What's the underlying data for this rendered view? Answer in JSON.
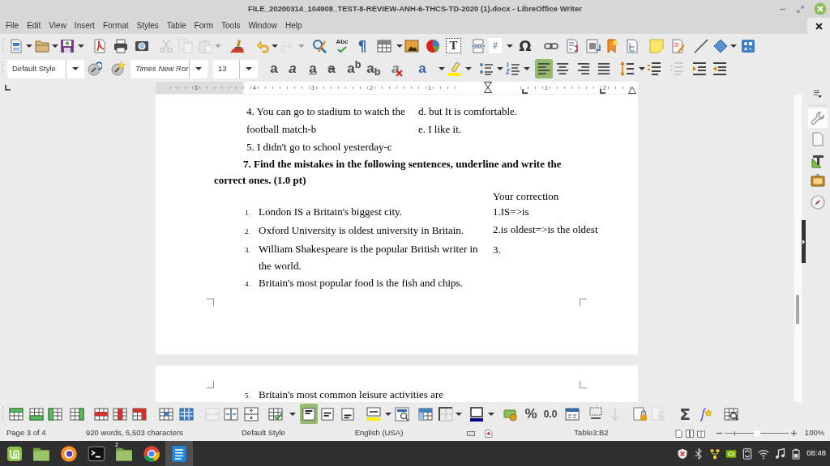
{
  "window": {
    "title": "FILE_20200314_104908_TEST-8-REVIEW-ANH-6-THCS-TD-2020 (1).docx - LibreOffice Writer"
  },
  "menu": [
    "File",
    "Edit",
    "View",
    "Insert",
    "Format",
    "Styles",
    "Table",
    "Form",
    "Tools",
    "Window",
    "Help"
  ],
  "standard_toolbar": {
    "cut": {
      "disabled": true
    },
    "copy": {
      "disabled": true
    },
    "paste": {
      "disabled": true
    },
    "redo": {
      "disabled": true
    },
    "spelling": "Abc",
    "formatting_marks": "¶",
    "text_box": "T",
    "insert_field": "#",
    "special_character": "Ω"
  },
  "formatting_toolbar": {
    "paragraph_style": "Default Style",
    "font_name": "Times New Ror",
    "font_size": "13",
    "bold": "a",
    "italic": "a",
    "underline": "a",
    "strikethrough": "a",
    "superscript": "a$^{b}$",
    "subscript": "a$_{b}$",
    "clear_formatting": "a",
    "font_color": "a",
    "alignment": [
      {
        "kind": "left",
        "selected": true
      },
      {
        "kind": "center",
        "selected": false
      },
      {
        "kind": "right",
        "selected": false
      },
      {
        "kind": "justify",
        "selected": false
      }
    ],
    "decrease_spacing": {
      "disabled": true
    }
  },
  "ruler": {
    "left_labels": [
      "5",
      "4",
      "3",
      "2",
      "1"
    ],
    "right_labels": [
      "1",
      "2"
    ]
  },
  "document": {
    "matching_table": {
      "left": [
        "4. You can go to stadium to watch the football match-b",
        "5. I didn't go to school yesterday-c"
      ],
      "right": [
        "d. but It is comfortable.",
        "e. I like it."
      ]
    },
    "exercise_heading": "7. Find the mistakes in the following sentences, underline and write the correct ones. (1.0 pt)",
    "mistakes_table": {
      "header": "Your correction",
      "sentences": [
        {
          "number": "1.",
          "text": "London IS a Britain's biggest city."
        },
        {
          "number": "2.",
          "text": "Oxford University is oldest university in Britain."
        },
        {
          "number": "3.",
          "text": "William Shakespeare is the popular British writer in the world."
        },
        {
          "number": "4.",
          "text": "Britain's most popular food is the fish and chips."
        }
      ],
      "answers": [
        "1.IS=>is",
        "2.is oldest=>is the oldest",
        "3."
      ]
    },
    "next_page_table": {
      "sentences": [
        {
          "number": "5.",
          "text": "Britain's most common leisure activities are"
        }
      ]
    }
  },
  "sidebar": {
    "decks": [
      {
        "kind": "properties",
        "selected": true
      },
      {
        "kind": "page",
        "selected": false
      },
      {
        "kind": "styles",
        "selected": false
      },
      {
        "kind": "gallery",
        "selected": false
      },
      {
        "kind": "navigator",
        "selected": false
      }
    ]
  },
  "table_toolbar": {
    "merge_cells": {
      "disabled": true
    },
    "vertical_alignment": [
      {
        "kind": "top",
        "selected": true
      },
      {
        "kind": "center",
        "selected": false
      },
      {
        "kind": "bottom",
        "selected": false
      }
    ],
    "percent": "%",
    "number_format": "0.0",
    "sort": {
      "disabled": true
    },
    "unprotect": {
      "disabled": true
    },
    "sum": "Σ"
  },
  "status_bar": {
    "page": "Page 3 of 4",
    "word_count": "920 words, 5,503 characters",
    "page_style": "Default Style",
    "language": "English (USA)",
    "table_cell": "Table3:B2",
    "zoom_slider": {
      "level": 0.5
    },
    "zoom": "100%"
  },
  "taskbar": {
    "apps": [
      {
        "kind": "files",
        "selected": false
      },
      {
        "kind": "firefox",
        "selected": false
      },
      {
        "kind": "terminal",
        "selected": false
      },
      {
        "kind": "files",
        "selected": false,
        "windows": "2"
      },
      {
        "kind": "chrome",
        "selected": false
      },
      {
        "kind": "writer",
        "selected": true
      }
    ],
    "clock": "08:48"
  }
}
